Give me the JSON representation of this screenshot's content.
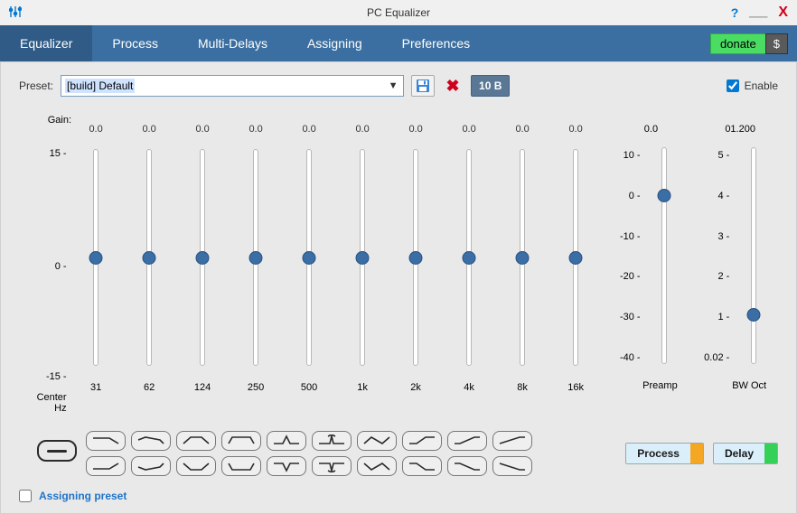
{
  "title": "PC Equalizer",
  "menubar": {
    "tabs": [
      "Equalizer",
      "Process",
      "Multi-Delays",
      "Assigning",
      "Preferences"
    ],
    "active": 0,
    "donate": "donate",
    "donate_symbol": "$"
  },
  "preset": {
    "label": "Preset:",
    "value": "[build] Default",
    "band_count": "10 B"
  },
  "enable": {
    "label": "Enable",
    "checked": true
  },
  "gain_label": "Gain:",
  "left_ticks": {
    "top": "15 -",
    "mid": "0 -",
    "bot": "-15 -",
    "center": "Center\nHz"
  },
  "bands": [
    {
      "gain": "0.0",
      "freq": "31",
      "pos": 0.5
    },
    {
      "gain": "0.0",
      "freq": "62",
      "pos": 0.5
    },
    {
      "gain": "0.0",
      "freq": "124",
      "pos": 0.5
    },
    {
      "gain": "0.0",
      "freq": "250",
      "pos": 0.5
    },
    {
      "gain": "0.0",
      "freq": "500",
      "pos": 0.5
    },
    {
      "gain": "0.0",
      "freq": "1k",
      "pos": 0.5
    },
    {
      "gain": "0.0",
      "freq": "2k",
      "pos": 0.5
    },
    {
      "gain": "0.0",
      "freq": "4k",
      "pos": 0.5
    },
    {
      "gain": "0.0",
      "freq": "8k",
      "pos": 0.5
    },
    {
      "gain": "0.0",
      "freq": "16k",
      "pos": 0.5
    }
  ],
  "preamp": {
    "value": "0.0",
    "name": "Preamp",
    "pos": 0.2,
    "ticks": [
      {
        "l": "10 -",
        "p": 0.0
      },
      {
        "l": "0 -",
        "p": 0.2
      },
      {
        "l": "-10 -",
        "p": 0.4
      },
      {
        "l": "-20 -",
        "p": 0.6
      },
      {
        "l": "-30 -",
        "p": 0.8
      },
      {
        "l": "-40 -",
        "p": 1.0
      }
    ]
  },
  "bwoct": {
    "value": "01.200",
    "name": "BW Oct",
    "pos": 0.79,
    "ticks": [
      {
        "l": "5 -",
        "p": 0.0
      },
      {
        "l": "4 -",
        "p": 0.2
      },
      {
        "l": "3 -",
        "p": 0.4
      },
      {
        "l": "2 -",
        "p": 0.6
      },
      {
        "l": "1 -",
        "p": 0.8
      },
      {
        "l": "0.02 -",
        "p": 1.0
      }
    ]
  },
  "shape_paths_top": [
    "M2 4 L20 4 L30 10",
    "M2 6 L10 3 L26 6 L30 10",
    "M2 10 L10 3 L22 3 L30 10",
    "M2 10 L6 3 L26 3 L30 10",
    "M2 10 L12 10 L16 2 L20 10 L30 10",
    "M2 10 L14 10 L16 2 L18 10 L30 10 M16 0 L16 4 M12 2 L16 0 L20 2",
    "M2 10 L10 3 L22 10 L30 3",
    "M2 10 L10 10 L20 3 L30 3",
    "M2 10 L8 10 L24 3 L30 3",
    "M2 10 L24 3 L30 3"
  ],
  "shape_paths_bot": [
    "M2 10 L20 10 L30 4",
    "M2 8 L10 11 L26 8 L30 4",
    "M2 4 L10 11 L22 11 L30 4",
    "M2 4 L6 11 L26 11 L30 4",
    "M2 4 L12 4 L16 12 L20 4 L30 4",
    "M2 4 L14 4 L16 12 L18 4 L30 4 M16 14 L16 10 M12 12 L16 14 L20 12",
    "M2 4 L10 11 L22 4 L30 11",
    "M2 4 L10 4 L20 11 L30 11",
    "M2 4 L8 4 L24 11 L30 11",
    "M2 4 L24 11 L30 11"
  ],
  "buttons": {
    "process": "Process",
    "delay": "Delay"
  },
  "assign": {
    "label": "Assigning preset",
    "checked": false
  }
}
